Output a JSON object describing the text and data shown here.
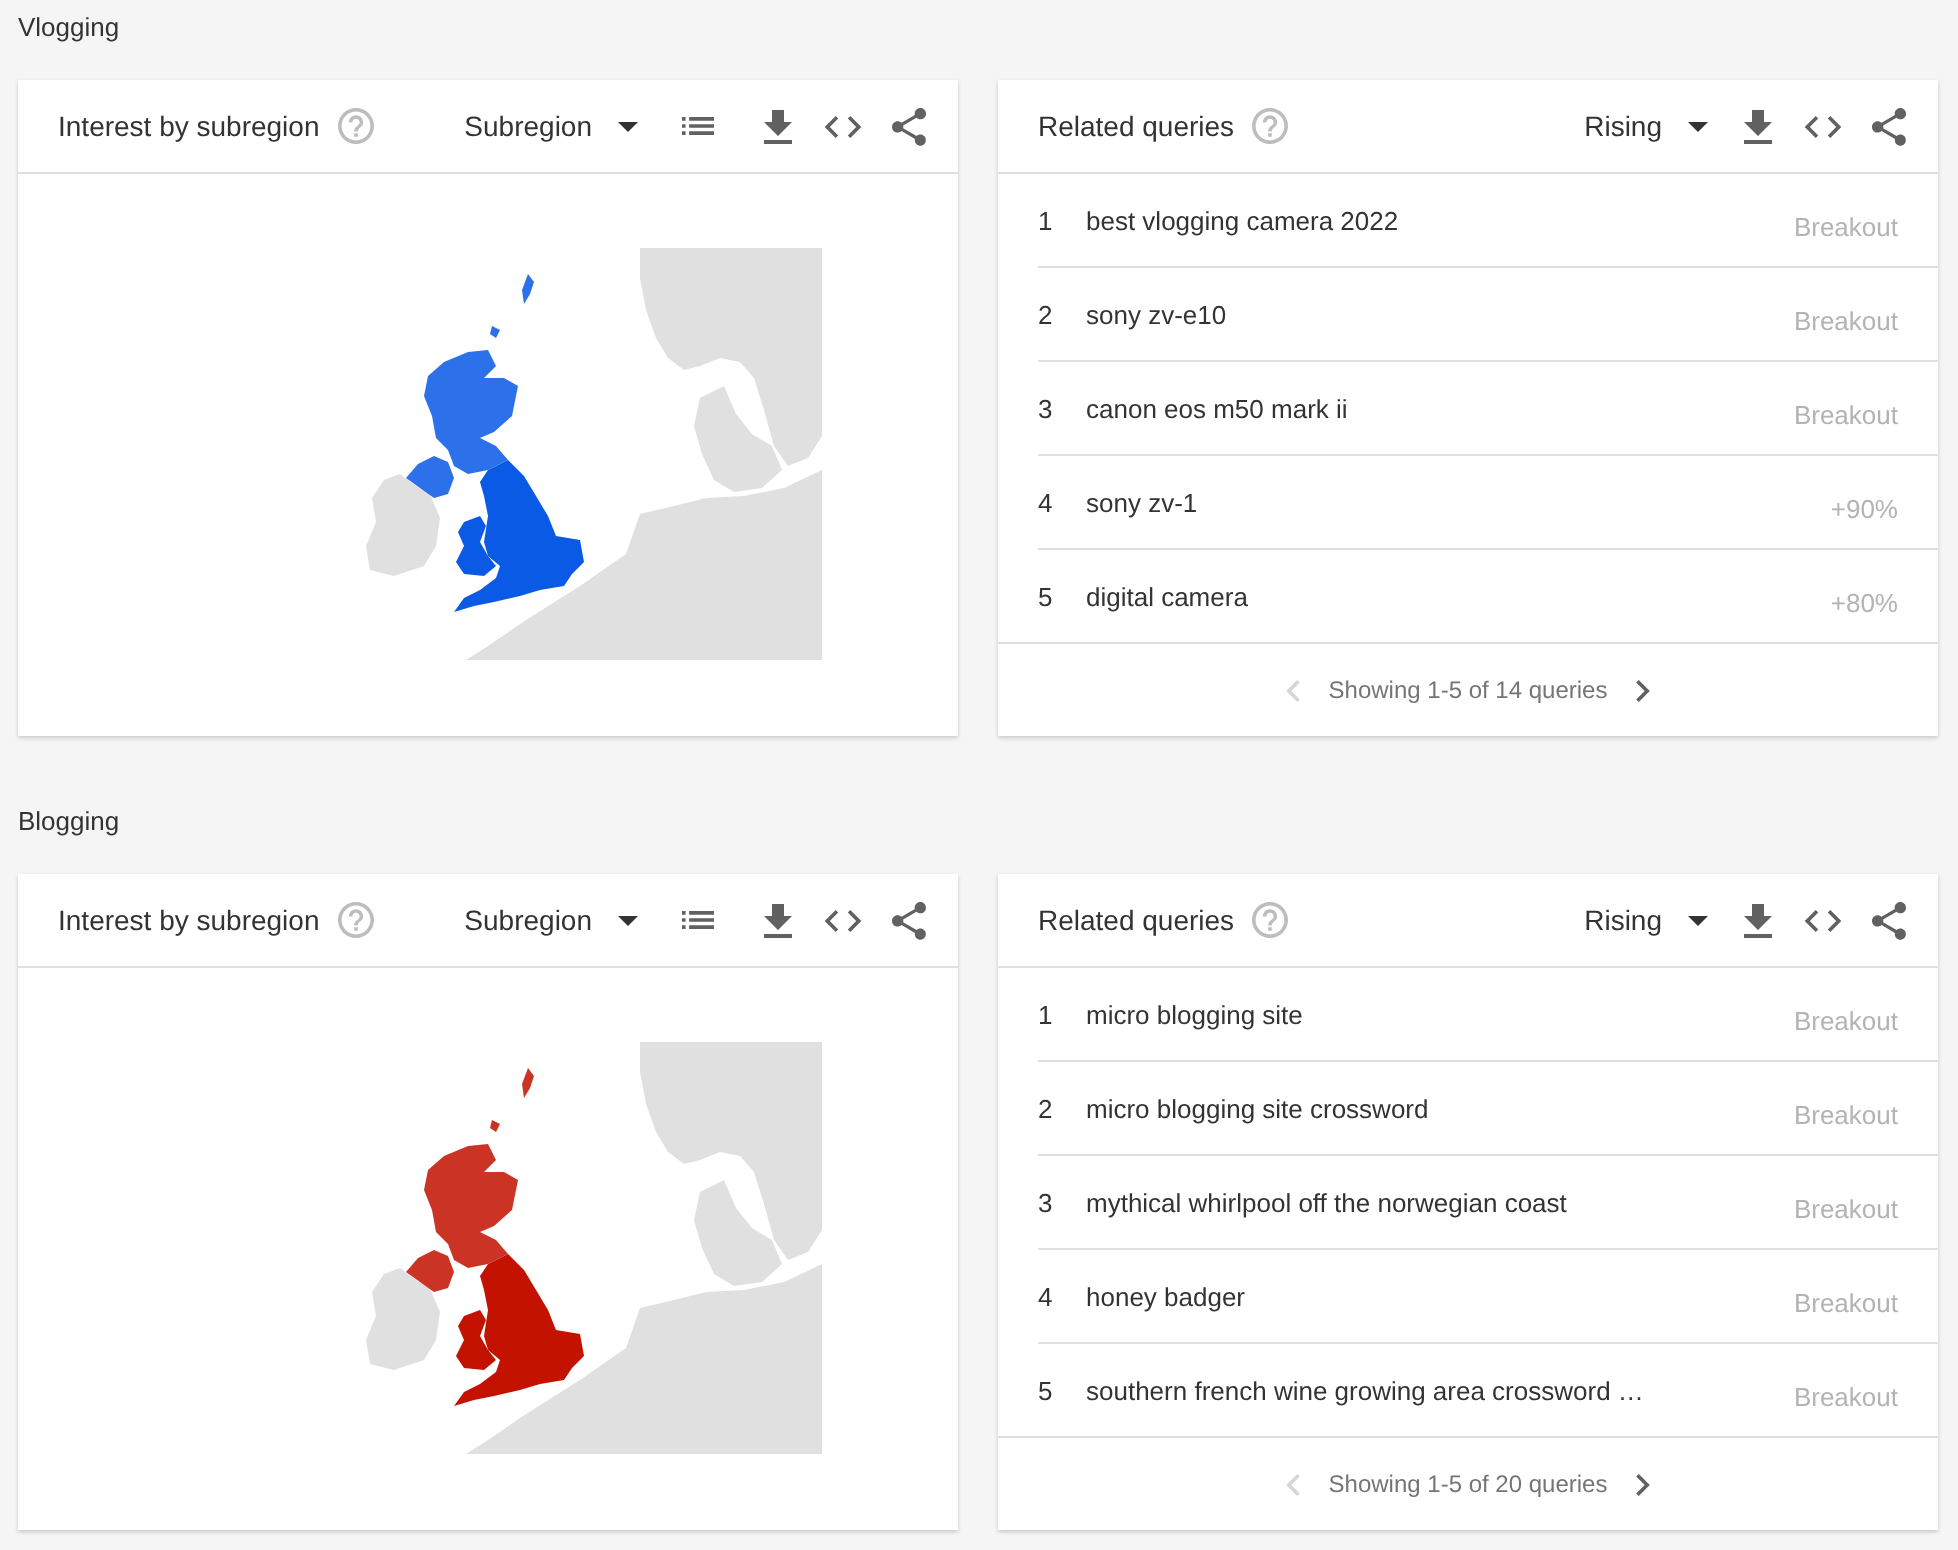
{
  "sections": [
    {
      "title": "Vlogging",
      "subregion_card": {
        "title": "Interest by subregion",
        "dropdown": "Subregion",
        "map": {
          "color": "#0a5ae6"
        }
      },
      "queries_card": {
        "title": "Related queries",
        "dropdown": "Rising",
        "rows": [
          {
            "rank": "1",
            "query": "best vlogging camera 2022",
            "value": "Breakout"
          },
          {
            "rank": "2",
            "query": "sony zv-e10",
            "value": "Breakout"
          },
          {
            "rank": "3",
            "query": "canon eos m50 mark ii",
            "value": "Breakout"
          },
          {
            "rank": "4",
            "query": "sony zv-1",
            "value": "+90%"
          },
          {
            "rank": "5",
            "query": "digital camera",
            "value": "+80%"
          }
        ],
        "pagination": {
          "text": "Showing 1-5 of 14 queries",
          "previous_disabled": true,
          "next_disabled": false
        }
      }
    },
    {
      "title": "Blogging",
      "subregion_card": {
        "title": "Interest by subregion",
        "dropdown": "Subregion",
        "map": {
          "color": "#c31300"
        }
      },
      "queries_card": {
        "title": "Related queries",
        "dropdown": "Rising",
        "rows": [
          {
            "rank": "1",
            "query": "micro blogging site",
            "value": "Breakout"
          },
          {
            "rank": "2",
            "query": "micro blogging site crossword",
            "value": "Breakout"
          },
          {
            "rank": "3",
            "query": "mythical whirlpool off the norwegian coast",
            "value": "Breakout"
          },
          {
            "rank": "4",
            "query": "honey badger",
            "value": "Breakout"
          },
          {
            "rank": "5",
            "query": "southern french wine growing area crossword …",
            "value": "Breakout"
          }
        ],
        "pagination": {
          "text": "Showing 1-5 of 20 queries",
          "previous_disabled": true,
          "next_disabled": false
        }
      }
    }
  ]
}
